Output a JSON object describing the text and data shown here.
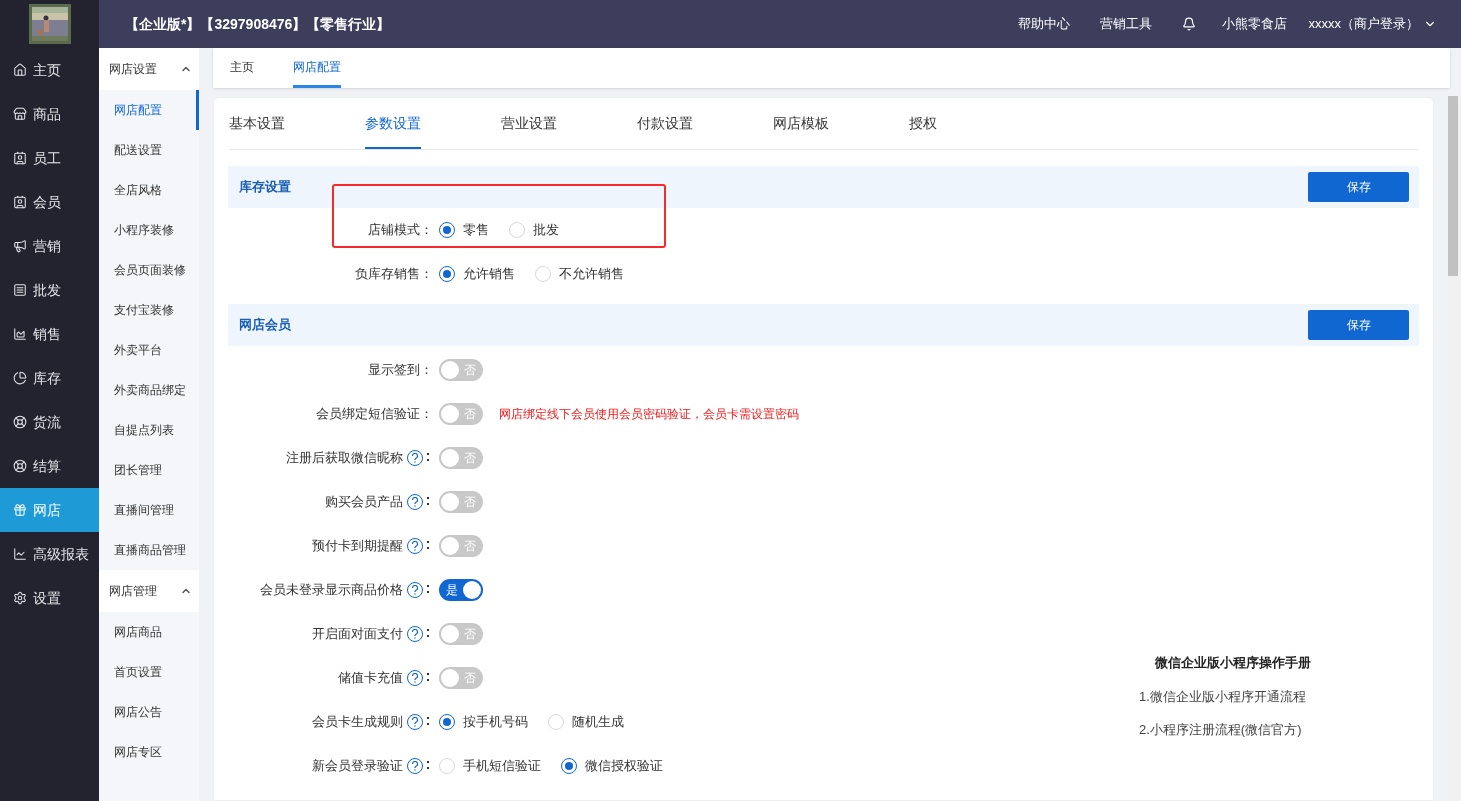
{
  "header": {
    "edition": "【企业版*】【3297908476】【零售行业】",
    "links": [
      "帮助中心",
      "营销工具"
    ],
    "shop": "小熊零食店",
    "user": "xxxxx（商户登录）"
  },
  "sidebar": {
    "items": [
      {
        "label": "主页",
        "selected": false
      },
      {
        "label": "商品",
        "selected": false
      },
      {
        "label": "员工",
        "selected": false
      },
      {
        "label": "会员",
        "selected": false
      },
      {
        "label": "营销",
        "selected": false
      },
      {
        "label": "批发",
        "selected": false
      },
      {
        "label": "销售",
        "selected": false
      },
      {
        "label": "库存",
        "selected": false
      },
      {
        "label": "货流",
        "selected": false
      },
      {
        "label": "结算",
        "selected": false
      },
      {
        "label": "网店",
        "selected": true
      },
      {
        "label": "高级报表",
        "selected": false
      },
      {
        "label": "设置",
        "selected": false
      }
    ]
  },
  "submenu": {
    "groups": [
      {
        "title": "网店设置",
        "expanded": true,
        "items": [
          {
            "label": "网店配置",
            "selected": true
          },
          {
            "label": "配送设置",
            "selected": false
          },
          {
            "label": "全店风格",
            "selected": false
          },
          {
            "label": "小程序装修",
            "selected": false
          },
          {
            "label": "会员页面装修",
            "selected": false
          },
          {
            "label": "支付宝装修",
            "selected": false
          },
          {
            "label": "外卖平台",
            "selected": false
          },
          {
            "label": "外卖商品绑定",
            "selected": false
          },
          {
            "label": "自提点列表",
            "selected": false
          },
          {
            "label": "团长管理",
            "selected": false
          },
          {
            "label": "直播间管理",
            "selected": false
          },
          {
            "label": "直播商品管理",
            "selected": false
          }
        ]
      },
      {
        "title": "网店管理",
        "expanded": true,
        "items": [
          {
            "label": "网店商品",
            "selected": false
          },
          {
            "label": "首页设置",
            "selected": false
          },
          {
            "label": "网店公告",
            "selected": false
          },
          {
            "label": "网店专区",
            "selected": false
          }
        ]
      }
    ]
  },
  "page_tabs": [
    {
      "label": "主页",
      "selected": false
    },
    {
      "label": "网店配置",
      "selected": true
    }
  ],
  "tabs": [
    {
      "label": "基本设置",
      "selected": false
    },
    {
      "label": "参数设置",
      "selected": true
    },
    {
      "label": "营业设置",
      "selected": false
    },
    {
      "label": "付款设置",
      "selected": false
    },
    {
      "label": "网店模板",
      "selected": false
    },
    {
      "label": "授权",
      "selected": false
    }
  ],
  "sections": [
    {
      "title": "库存设置",
      "save": "保存",
      "fields": [
        {
          "kind": "radio",
          "label": "店铺模式：",
          "help": false,
          "highlighted": true,
          "options": [
            {
              "label": "零售",
              "selected": true
            },
            {
              "label": "批发",
              "selected": false
            }
          ]
        },
        {
          "kind": "radio",
          "label": "负库存销售：",
          "help": false,
          "highlighted": false,
          "options": [
            {
              "label": "允许销售",
              "selected": true
            },
            {
              "label": "不允许销售",
              "selected": false
            }
          ]
        }
      ]
    },
    {
      "title": "网店会员",
      "save": "保存",
      "fields": [
        {
          "kind": "toggle",
          "label": "显示签到：",
          "help": false,
          "highlighted": false,
          "on": false,
          "text": "否"
        },
        {
          "kind": "toggle",
          "label": "会员绑定短信验证：",
          "help": false,
          "highlighted": false,
          "on": false,
          "text": "否",
          "note": "网店绑定线下会员使用会员密码验证，会员卡需设置密码"
        },
        {
          "kind": "toggle",
          "label": "注册后获取微信昵称",
          "help": true,
          "highlighted": false,
          "on": false,
          "text": "否"
        },
        {
          "kind": "toggle",
          "label": "购买会员产品",
          "help": true,
          "highlighted": false,
          "on": false,
          "text": "否"
        },
        {
          "kind": "toggle",
          "label": "预付卡到期提醒",
          "help": true,
          "highlighted": false,
          "on": false,
          "text": "否"
        },
        {
          "kind": "toggle",
          "label": "会员未登录显示商品价格",
          "help": true,
          "highlighted": false,
          "on": true,
          "text": "是"
        },
        {
          "kind": "toggle",
          "label": "开启面对面支付",
          "help": true,
          "highlighted": false,
          "on": false,
          "text": "否"
        },
        {
          "kind": "toggle",
          "label": "储值卡充值",
          "help": true,
          "highlighted": false,
          "on": false,
          "text": "否"
        },
        {
          "kind": "radio",
          "label": "会员卡生成规则",
          "help": true,
          "highlighted": false,
          "options": [
            {
              "label": "按手机号码",
              "selected": true
            },
            {
              "label": "随机生成",
              "selected": false
            }
          ]
        },
        {
          "kind": "radio",
          "label": "新会员登录验证",
          "help": true,
          "highlighted": false,
          "options": [
            {
              "label": "手机短信验证",
              "selected": false
            },
            {
              "label": "微信授权验证",
              "selected": true
            }
          ]
        }
      ]
    }
  ],
  "manual": {
    "title": "微信企业版小程序操作手册",
    "links": [
      "1.微信企业版小程序开通流程",
      "2.小程序注册流程(微信官方)"
    ]
  }
}
